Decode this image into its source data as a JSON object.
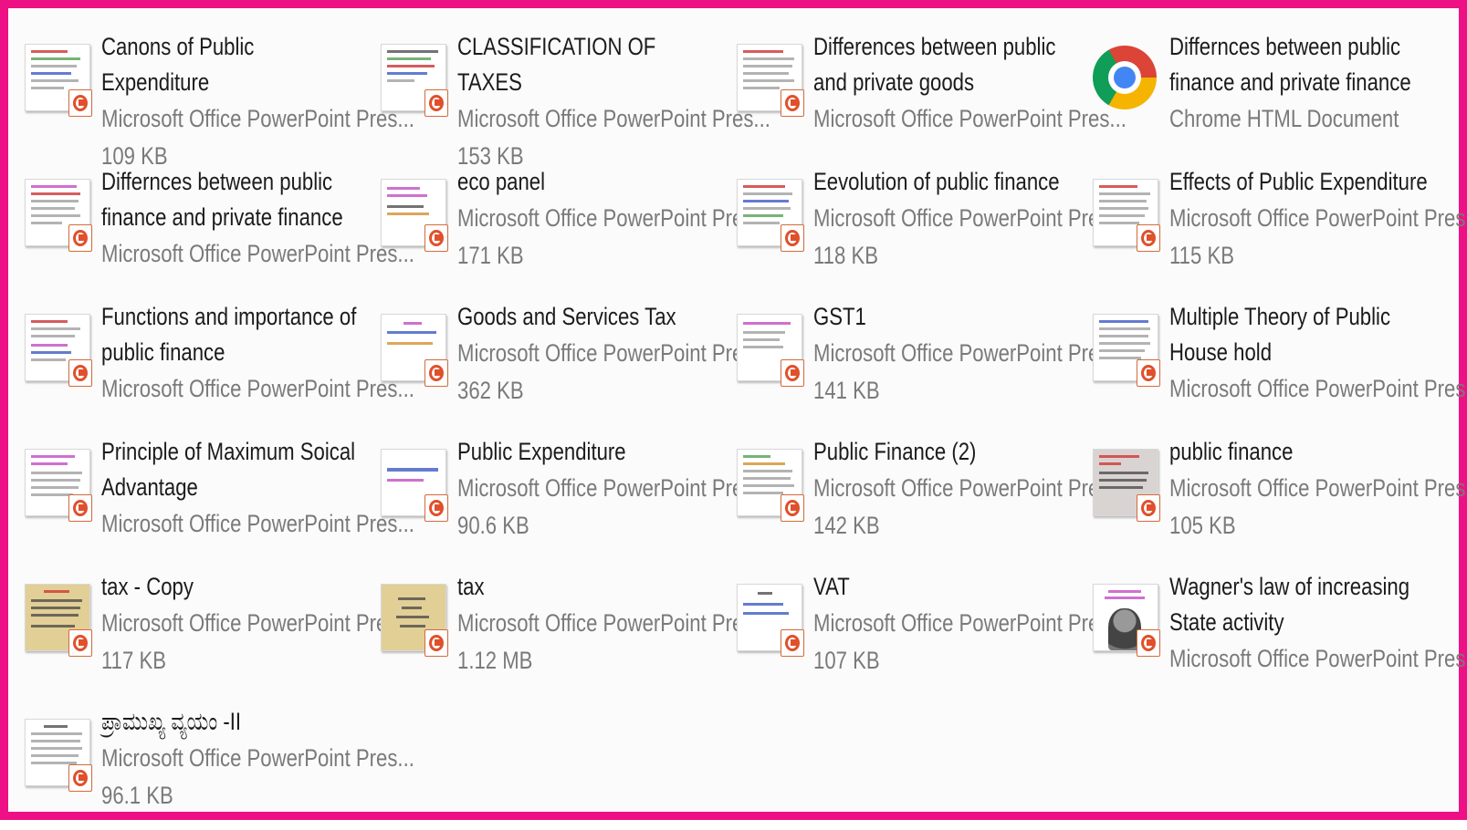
{
  "files": [
    {
      "name": "Canons of Public Expenditure",
      "type": "Microsoft Office PowerPoint Pres...",
      "size": "109 KB",
      "icon": "powerpoint-file-icon"
    },
    {
      "name": "CLASSIFICATION OF TAXES",
      "type": "Microsoft Office PowerPoint Pres...",
      "size": "153 KB",
      "icon": "powerpoint-file-icon"
    },
    {
      "name": "Differences between public and private goods",
      "type": "Microsoft Office PowerPoint Pres...",
      "size": "",
      "icon": "powerpoint-file-icon"
    },
    {
      "name": "Differnces between public finance and private finance",
      "type": "Chrome HTML Document",
      "size": "",
      "icon": "chrome-icon"
    },
    {
      "name": "Differnces between public finance and private finance",
      "type": "Microsoft Office PowerPoint Pres...",
      "size": "",
      "icon": "powerpoint-file-icon"
    },
    {
      "name": "eco panel",
      "type": "Microsoft Office PowerPoint Pres...",
      "size": "171 KB",
      "icon": "powerpoint-file-icon"
    },
    {
      "name": "Eevolution of public finance",
      "type": "Microsoft Office PowerPoint Pres...",
      "size": "118 KB",
      "icon": "powerpoint-file-icon"
    },
    {
      "name": "Effects of Public Expenditure",
      "type": "Microsoft Office PowerPoint Pres...",
      "size": "115 KB",
      "icon": "powerpoint-file-icon"
    },
    {
      "name": "Functions and importance of public finance",
      "type": "Microsoft Office PowerPoint Pres...",
      "size": "",
      "icon": "powerpoint-file-icon"
    },
    {
      "name": "Goods and Services Tax",
      "type": "Microsoft Office PowerPoint Pres...",
      "size": "362 KB",
      "icon": "powerpoint-file-icon"
    },
    {
      "name": "GST1",
      "type": "Microsoft Office PowerPoint Pres...",
      "size": "141 KB",
      "icon": "powerpoint-file-icon"
    },
    {
      "name": "Multiple Theory of Public House hold",
      "type": "Microsoft Office PowerPoint Pres...",
      "size": "",
      "icon": "powerpoint-file-icon"
    },
    {
      "name": "Principle of Maximum Soical Advantage",
      "type": "Microsoft Office PowerPoint Pres...",
      "size": "",
      "icon": "powerpoint-file-icon"
    },
    {
      "name": "Public Expenditure",
      "type": "Microsoft Office PowerPoint Pres...",
      "size": "90.6 KB",
      "icon": "powerpoint-file-icon"
    },
    {
      "name": "Public Finance (2)",
      "type": "Microsoft Office PowerPoint Pres...",
      "size": "142 KB",
      "icon": "powerpoint-file-icon"
    },
    {
      "name": "public finance",
      "type": "Microsoft Office PowerPoint Pres...",
      "size": "105 KB",
      "icon": "powerpoint-file-icon"
    },
    {
      "name": "tax - Copy",
      "type": "Microsoft Office PowerPoint Pres...",
      "size": "117 KB",
      "icon": "powerpoint-file-icon"
    },
    {
      "name": "tax",
      "type": "Microsoft Office PowerPoint Pres...",
      "size": "1.12 MB",
      "icon": "powerpoint-file-icon"
    },
    {
      "name": "VAT",
      "type": "Microsoft Office PowerPoint Pres...",
      "size": "107 KB",
      "icon": "powerpoint-file-icon"
    },
    {
      "name": "Wagner's law of increasing State activity",
      "type": "Microsoft Office PowerPoint Pres...",
      "size": "",
      "icon": "powerpoint-file-icon"
    },
    {
      "name": "ಪ್ರಾಮುಖ್ಯ ವ್ಯಯಂ -II",
      "type": "Microsoft Office PowerPoint Pres...",
      "size": "96.1 KB",
      "icon": "powerpoint-file-icon"
    }
  ],
  "colors": {
    "frame_border": "#ee1186",
    "name_text": "#1b1b1b",
    "meta_text": "#7a7a7a"
  }
}
